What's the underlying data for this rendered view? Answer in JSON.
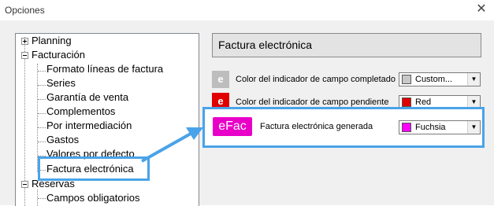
{
  "window": {
    "title": "Opciones",
    "close_glyph": "✕"
  },
  "tree": {
    "items": [
      {
        "label": "Planning",
        "expander": "+"
      },
      {
        "label": "Facturación",
        "expander": "-"
      },
      {
        "label": "Formato líneas de factura"
      },
      {
        "label": "Series"
      },
      {
        "label": "Garantía de venta"
      },
      {
        "label": "Complementos"
      },
      {
        "label": "Por intermediación"
      },
      {
        "label": "Gastos"
      },
      {
        "label": "Valores por defecto"
      },
      {
        "label": "Factura electrónica",
        "selected": true
      },
      {
        "label": "Reservas",
        "expander": "-"
      },
      {
        "label": "Campos obligatorios"
      }
    ],
    "scroll_up_glyph": "▲"
  },
  "panel": {
    "header": "Factura electrónica",
    "rows": [
      {
        "icon_text": "e",
        "icon_color": "#bdbdbd",
        "label": "Color del indicador de campo completado",
        "value": "Custom...",
        "swatch": "#c8c8c8"
      },
      {
        "icon_text": "e",
        "icon_color": "#e00000",
        "label": "Color del indicador de campo pendiente",
        "value": "Red",
        "swatch": "#e00000"
      }
    ],
    "highlight": {
      "icon_text": "eFac",
      "icon_color": "#e800c8",
      "label": "Factura electrónica generada",
      "value": "Fuchsia",
      "swatch": "#ff00ff"
    },
    "dropdown_glyph": "▼"
  },
  "colors": {
    "callout_border": "#4aa3e8"
  }
}
